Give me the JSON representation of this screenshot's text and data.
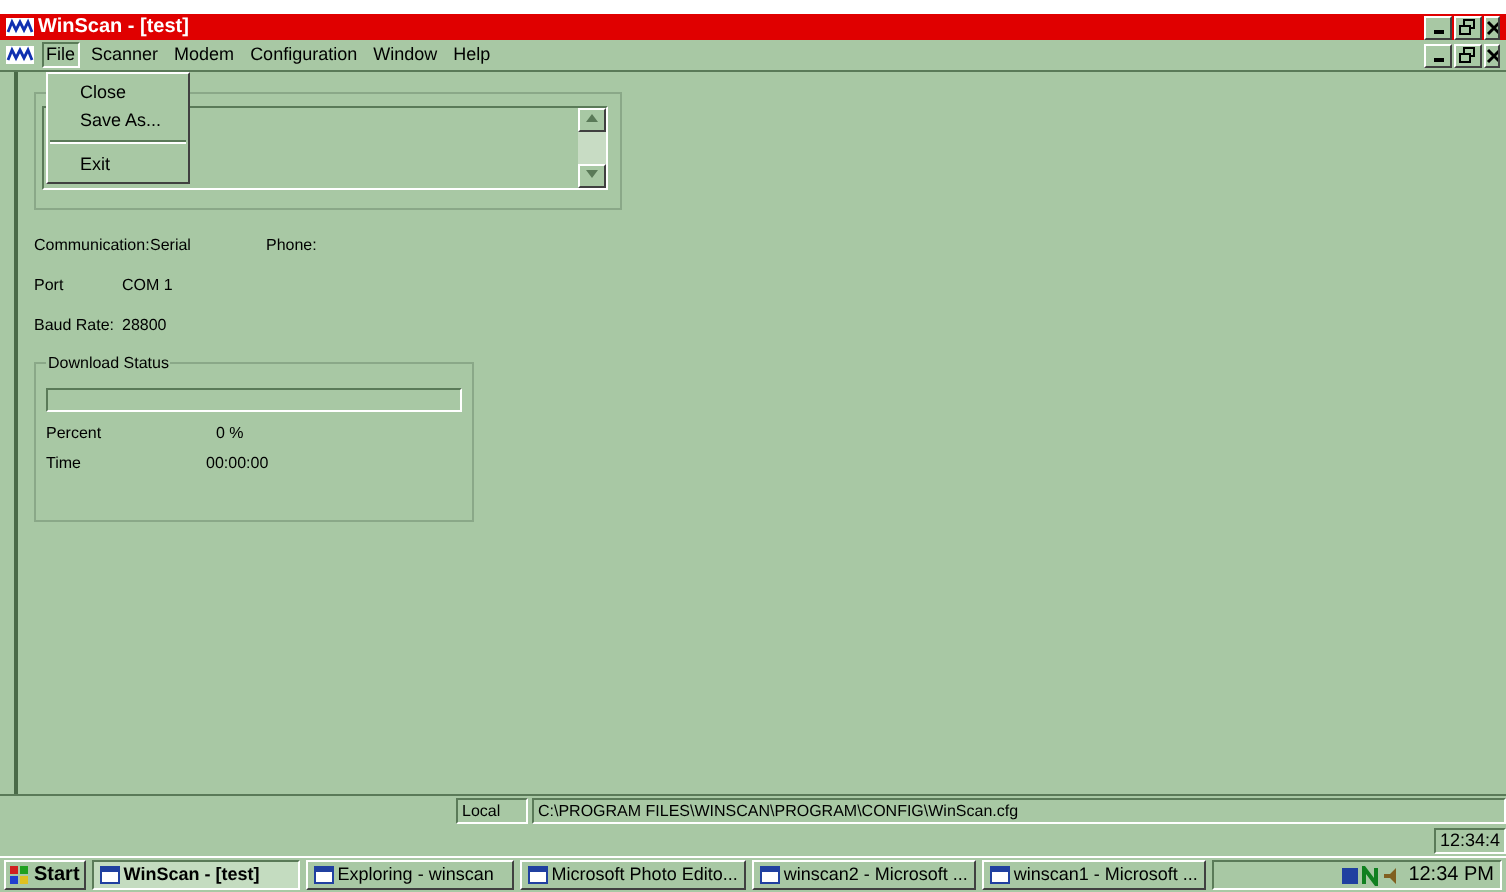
{
  "window": {
    "title": "WinScan - [test]"
  },
  "menu": [
    {
      "label": "File",
      "selected": true
    },
    {
      "label": "Scanner",
      "selected": false
    },
    {
      "label": "Modem",
      "selected": false
    },
    {
      "label": "Configuration",
      "selected": false
    },
    {
      "label": "Window",
      "selected": false
    },
    {
      "label": "Help",
      "selected": false
    }
  ],
  "file_menu": [
    {
      "kind": "item",
      "label": "Close"
    },
    {
      "kind": "item",
      "label": "Save As..."
    },
    {
      "kind": "separator"
    },
    {
      "kind": "item",
      "label": "Exit"
    }
  ],
  "info": {
    "communication_label": "Communication:",
    "communication": "Serial",
    "phone_label": "Phone:",
    "port_label": "Port",
    "port": "COM 1",
    "baud_label": "Baud Rate:",
    "baud": "28800"
  },
  "download_status": {
    "title": "Download Status",
    "level": 0,
    "percent_label": "Percent",
    "percent": "0 %",
    "time_label": "Time",
    "time": "00:00:00"
  },
  "status_bar": {
    "mode": "Local",
    "path": "C:\\PROGRAM FILES\\WINSCAN\\PROGRAM\\CONFIG\\WinScan.cfg",
    "clock": "12:34:4"
  },
  "taskbar": {
    "start": "Start",
    "buttons": [
      {
        "label": "WinScan - [test]",
        "selected": true
      },
      {
        "label": "Exploring - winscan",
        "selected": false
      },
      {
        "label": "Microsoft Photo Edito...",
        "selected": false
      },
      {
        "label": "winscan2 - Microsoft ...",
        "selected": false
      },
      {
        "label": "winscan1 - Microsoft ...",
        "selected": false
      }
    ],
    "time": "12:34 PM"
  }
}
